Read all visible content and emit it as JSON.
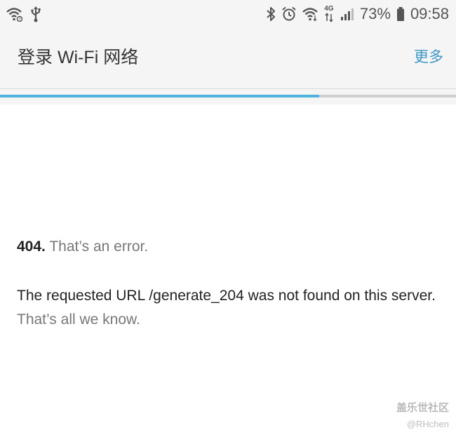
{
  "status_bar": {
    "battery_percent": "73%",
    "time": "09:58",
    "network_type": "4G",
    "left_icons": [
      "wifi-question-icon",
      "usb-icon"
    ],
    "right_icons": [
      "bluetooth-icon",
      "alarm-icon",
      "wifi-icon",
      "mobile-data-icon",
      "signal-icon",
      "battery-icon"
    ]
  },
  "app_bar": {
    "title": "登录 Wi-Fi 网络",
    "more_label": "更多"
  },
  "progress": {
    "value": 0.7,
    "fill_color": "#4fb3e0"
  },
  "error": {
    "code": "404.",
    "summary": " That’s an error.",
    "message_main": "The requested URL /generate_204 was not found on this server.",
    "message_tail": " That’s all we know."
  },
  "watermark": {
    "brand": "盖乐世社区",
    "user": "@RHchen"
  },
  "colors": {
    "accent": "#3f97c4",
    "text": "#222222",
    "muted": "#777777",
    "bar_bg": "#f5f5f5"
  }
}
